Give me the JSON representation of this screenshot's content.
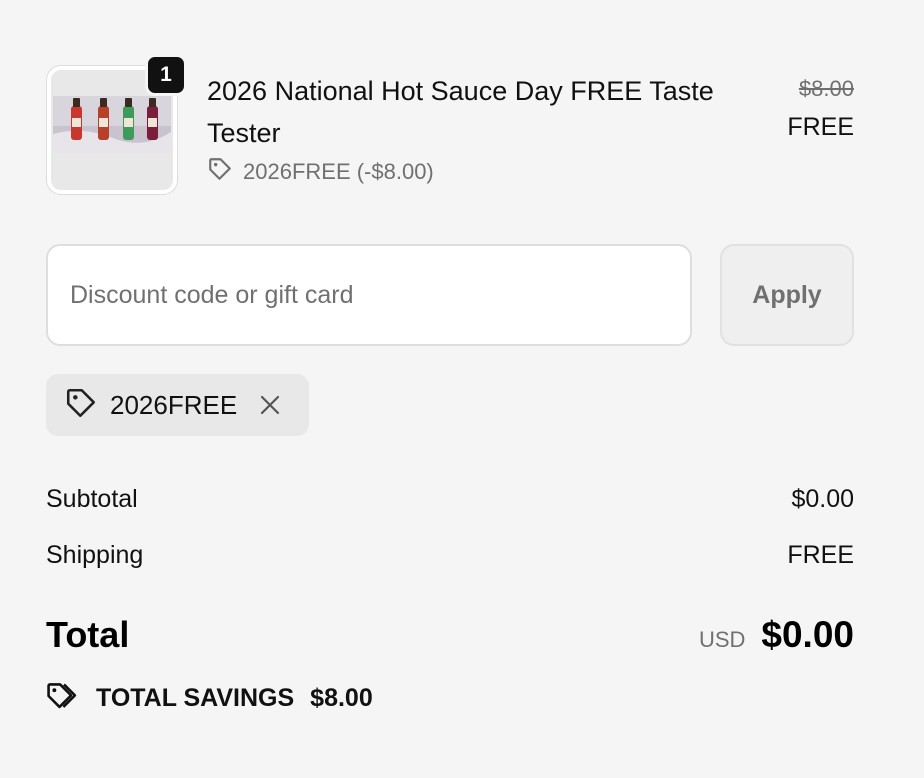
{
  "line_item": {
    "quantity": "1",
    "title": "2026 National Hot Sauce Day FREE Taste Tester",
    "discount_line": "2026FREE (-$8.00)",
    "original_price": "$8.00",
    "current_price": "FREE",
    "thumbnail_icon": "hot-sauce-bottles-image",
    "bottle_colors": [
      "#c8372d",
      "#b8402a",
      "#3f9b5a",
      "#7a1e3a"
    ]
  },
  "discount_form": {
    "placeholder": "Discount code or gift card",
    "value": "",
    "apply_label": "Apply"
  },
  "applied_code": {
    "label": "2026FREE",
    "tag_icon": "tag-icon",
    "remove_icon": "close-icon"
  },
  "totals": {
    "subtotal_label": "Subtotal",
    "subtotal_value": "$0.00",
    "shipping_label": "Shipping",
    "shipping_value": "FREE",
    "total_label": "Total",
    "currency": "USD",
    "total_value": "$0.00",
    "savings_label": "TOTAL SAVINGS",
    "savings_value": "$8.00",
    "savings_icon": "tags-icon"
  },
  "colors": {
    "background": "#f5f5f5",
    "text": "#111111",
    "muted": "#707070",
    "badge": "#111111"
  }
}
